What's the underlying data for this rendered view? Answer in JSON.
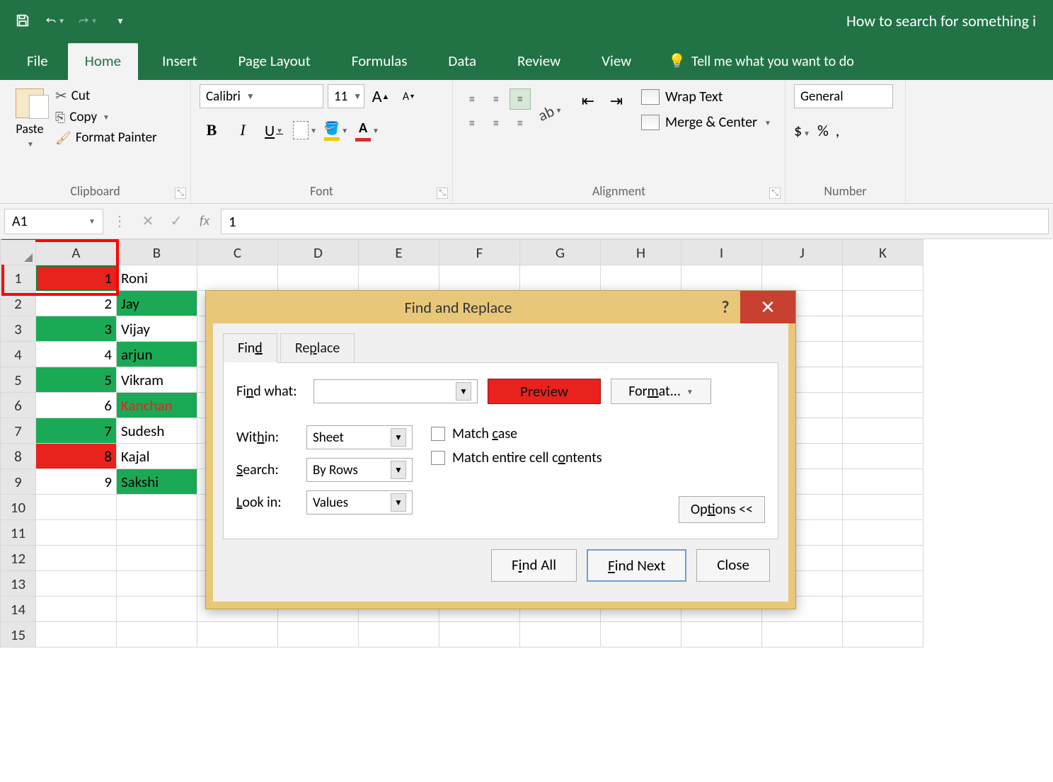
{
  "title": "How to search for something i",
  "tabs": {
    "file": "File",
    "home": "Home",
    "insert": "Insert",
    "pageLayout": "Page Layout",
    "formulas": "Formulas",
    "data": "Data",
    "review": "Review",
    "view": "View",
    "tellMe": "Tell me what you want to do"
  },
  "ribbon": {
    "clipboard": {
      "paste": "Paste",
      "cut": "Cut",
      "copy": "Copy",
      "formatPainter": "Format Painter",
      "label": "Clipboard"
    },
    "font": {
      "name": "Calibri",
      "size": "11",
      "label": "Font",
      "bold": "B",
      "italic": "I",
      "underline": "U"
    },
    "alignment": {
      "wrap": "Wrap Text",
      "merge": "Merge & Center",
      "label": "Alignment"
    },
    "number": {
      "format": "General",
      "label": "Number",
      "dollar": "$",
      "percent": "%",
      "comma": ","
    }
  },
  "formulaBar": {
    "name": "A1",
    "value": "1"
  },
  "columns": [
    "A",
    "B",
    "C",
    "D",
    "E",
    "F",
    "G",
    "H",
    "I",
    "J",
    "K"
  ],
  "rows": [
    {
      "n": "1",
      "a": "1",
      "aBg": "red",
      "b": "Roni",
      "bBg": ""
    },
    {
      "n": "2",
      "a": "2",
      "aBg": "",
      "b": "Jay",
      "bBg": "green"
    },
    {
      "n": "3",
      "a": "3",
      "aBg": "green",
      "b": "Vijay",
      "bBg": ""
    },
    {
      "n": "4",
      "a": "4",
      "aBg": "",
      "b": "arjun",
      "bBg": "green"
    },
    {
      "n": "5",
      "a": "5",
      "aBg": "green",
      "b": "Vikram",
      "bBg": ""
    },
    {
      "n": "6",
      "a": "6",
      "aBg": "",
      "b": "Kanchan",
      "bBg": "green",
      "bTxt": "red"
    },
    {
      "n": "7",
      "a": "7",
      "aBg": "green",
      "b": "Sudesh",
      "bBg": ""
    },
    {
      "n": "8",
      "a": "8",
      "aBg": "red",
      "b": "Kajal",
      "bBg": ""
    },
    {
      "n": "9",
      "a": "9",
      "aBg": "",
      "b": "Sakshi",
      "bBg": "green"
    },
    {
      "n": "10",
      "a": "",
      "b": ""
    },
    {
      "n": "11",
      "a": "",
      "b": ""
    },
    {
      "n": "12",
      "a": "",
      "b": ""
    },
    {
      "n": "13",
      "a": "",
      "b": ""
    },
    {
      "n": "14",
      "a": "",
      "b": ""
    },
    {
      "n": "15",
      "a": "",
      "b": ""
    }
  ],
  "dialog": {
    "title": "Find and Replace",
    "tabs": {
      "find": "Find",
      "replace": "Replace"
    },
    "findWhat": "Find what:",
    "findValue": "",
    "preview": "Preview",
    "format": "Format...",
    "within": "Within:",
    "withinVal": "Sheet",
    "search": "Search:",
    "searchVal": "By Rows",
    "lookIn": "Look in:",
    "lookInVal": "Values",
    "matchCase": "Match case",
    "matchContents": "Match entire cell contents",
    "options": "Options <<",
    "findAll": "Find All",
    "findNext": "Find Next",
    "close": "Close"
  }
}
